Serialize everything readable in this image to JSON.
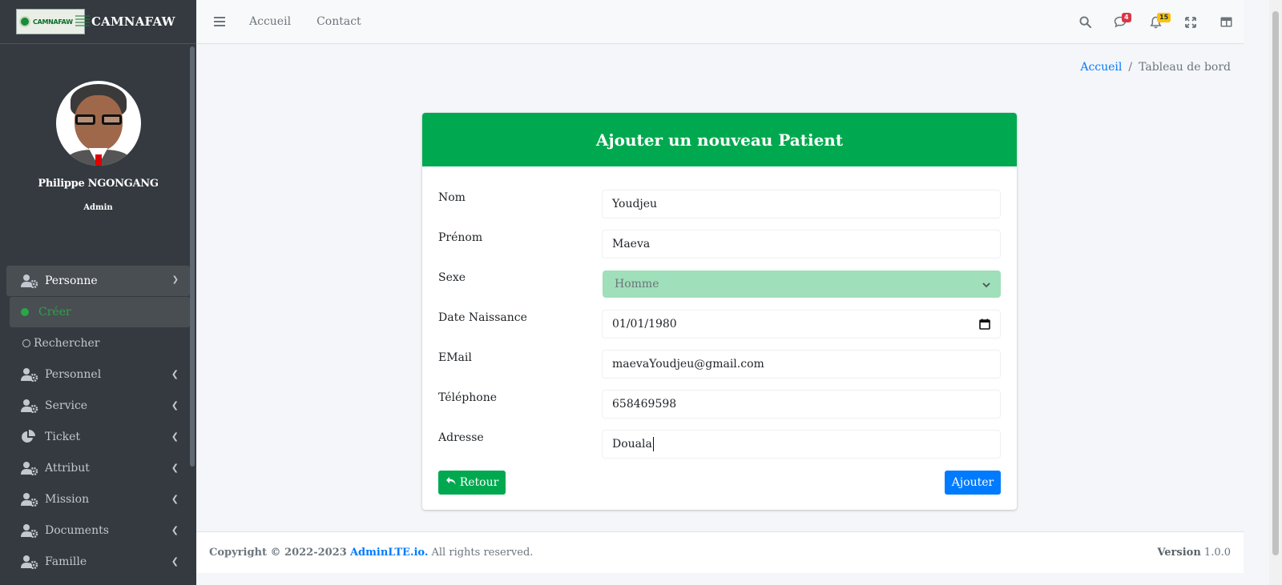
{
  "brand": {
    "name": "CAMNAFAW",
    "logo_text": "CAMNAFAW"
  },
  "user": {
    "name": "Philippe NGONGANG",
    "role": "Admin"
  },
  "sidebar": {
    "items": [
      {
        "label": "Personne",
        "icon": "users-cog-icon",
        "expanded": true
      },
      {
        "label": "Personnel",
        "icon": "users-cog-icon"
      },
      {
        "label": "Service",
        "icon": "users-cog-icon"
      },
      {
        "label": "Ticket",
        "icon": "pie-chart-icon"
      },
      {
        "label": "Attribut",
        "icon": "users-cog-icon"
      },
      {
        "label": "Mission",
        "icon": "users-cog-icon"
      },
      {
        "label": "Documents",
        "icon": "users-cog-icon"
      },
      {
        "label": "Famille",
        "icon": "users-cog-icon"
      }
    ],
    "subitems": [
      {
        "label": "Créer",
        "active": true
      },
      {
        "label": "Rechercher",
        "active": false
      }
    ]
  },
  "navbar": {
    "links": [
      "Accueil",
      "Contact"
    ],
    "messages_badge": "4",
    "notifications_badge": "15"
  },
  "breadcrumb": {
    "home": "Accueil",
    "current": "Tableau de bord"
  },
  "form": {
    "title": "Ajouter un nouveau Patient",
    "fields": [
      {
        "label": "Nom",
        "value": "Youdjeu"
      },
      {
        "label": "Prénom",
        "value": "Maeva"
      },
      {
        "label": "Sexe",
        "value": "Homme"
      },
      {
        "label": "Date Naissance",
        "value": "01/01/1980"
      },
      {
        "label": "EMail",
        "value": "maevaYoudjeu@gmail.com"
      },
      {
        "label": "Téléphone",
        "value": "658469598"
      },
      {
        "label": "Adresse",
        "value": "Douala"
      }
    ],
    "back_label": "Retour",
    "submit_label": "Ajouter"
  },
  "footer": {
    "copyright_prefix": "Copyright © 2022-2023",
    "link": "AdminLTE.io.",
    "suffix": "All rights reserved.",
    "version_label": "Version",
    "version_value": "1.0.0"
  },
  "colors": {
    "primary": "#007bff",
    "success": "#00a94f",
    "sidebar": "#343a40",
    "select_bg": "#9fdfb9"
  }
}
